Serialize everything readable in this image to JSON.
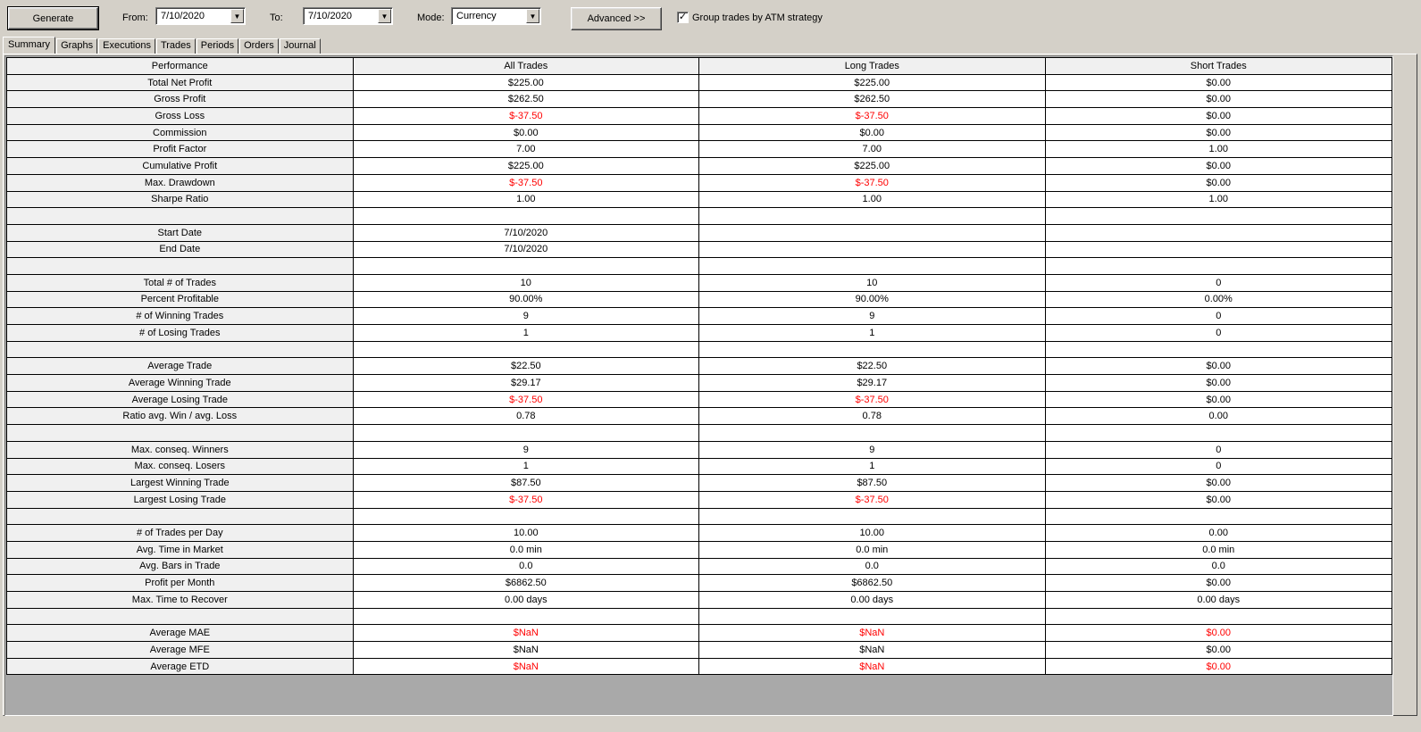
{
  "toolbar": {
    "generate_label": "Generate",
    "from_label": "From:",
    "from_value": "7/10/2020",
    "to_label": "To:",
    "to_value": "7/10/2020",
    "mode_label": "Mode:",
    "mode_value": "Currency",
    "advanced_label": "Advanced >>",
    "group_checked": true,
    "group_label": "Group trades by ATM strategy"
  },
  "tabs": [
    "Summary",
    "Graphs",
    "Executions",
    "Trades",
    "Periods",
    "Orders",
    "Journal"
  ],
  "active_tab": "Summary",
  "colors": {
    "negative": "#ff0000",
    "background": "#d4d0c8",
    "header": "#f0f0f0"
  },
  "table": {
    "columns": [
      "Performance",
      "All Trades",
      "Long Trades",
      "Short Trades"
    ],
    "rows": [
      {
        "label": "Total Net Profit",
        "values": [
          "$225.00",
          "$225.00",
          "$0.00"
        ],
        "neg": [
          false,
          false,
          false
        ]
      },
      {
        "label": "Gross Profit",
        "values": [
          "$262.50",
          "$262.50",
          "$0.00"
        ],
        "neg": [
          false,
          false,
          false
        ]
      },
      {
        "label": "Gross Loss",
        "values": [
          "$-37.50",
          "$-37.50",
          "$0.00"
        ],
        "neg": [
          true,
          true,
          false
        ]
      },
      {
        "label": "Commission",
        "values": [
          "$0.00",
          "$0.00",
          "$0.00"
        ],
        "neg": [
          false,
          false,
          false
        ]
      },
      {
        "label": "Profit Factor",
        "values": [
          "7.00",
          "7.00",
          "1.00"
        ],
        "neg": [
          false,
          false,
          false
        ]
      },
      {
        "label": "Cumulative Profit",
        "values": [
          "$225.00",
          "$225.00",
          "$0.00"
        ],
        "neg": [
          false,
          false,
          false
        ]
      },
      {
        "label": "Max. Drawdown",
        "values": [
          "$-37.50",
          "$-37.50",
          "$0.00"
        ],
        "neg": [
          true,
          true,
          false
        ]
      },
      {
        "label": "Sharpe Ratio",
        "values": [
          "1.00",
          "1.00",
          "1.00"
        ],
        "neg": [
          false,
          false,
          false
        ]
      },
      {
        "label": "",
        "values": [
          "",
          "",
          ""
        ],
        "neg": [
          false,
          false,
          false
        ]
      },
      {
        "label": "Start Date",
        "values": [
          "7/10/2020",
          "",
          ""
        ],
        "neg": [
          false,
          false,
          false
        ]
      },
      {
        "label": "End Date",
        "values": [
          "7/10/2020",
          "",
          ""
        ],
        "neg": [
          false,
          false,
          false
        ]
      },
      {
        "label": "",
        "values": [
          "",
          "",
          ""
        ],
        "neg": [
          false,
          false,
          false
        ]
      },
      {
        "label": "Total # of Trades",
        "values": [
          "10",
          "10",
          "0"
        ],
        "neg": [
          false,
          false,
          false
        ]
      },
      {
        "label": "Percent Profitable",
        "values": [
          "90.00%",
          "90.00%",
          "0.00%"
        ],
        "neg": [
          false,
          false,
          false
        ]
      },
      {
        "label": "# of Winning Trades",
        "values": [
          "9",
          "9",
          "0"
        ],
        "neg": [
          false,
          false,
          false
        ]
      },
      {
        "label": "# of Losing Trades",
        "values": [
          "1",
          "1",
          "0"
        ],
        "neg": [
          false,
          false,
          false
        ]
      },
      {
        "label": "",
        "values": [
          "",
          "",
          ""
        ],
        "neg": [
          false,
          false,
          false
        ]
      },
      {
        "label": "Average Trade",
        "values": [
          "$22.50",
          "$22.50",
          "$0.00"
        ],
        "neg": [
          false,
          false,
          false
        ]
      },
      {
        "label": "Average Winning Trade",
        "values": [
          "$29.17",
          "$29.17",
          "$0.00"
        ],
        "neg": [
          false,
          false,
          false
        ]
      },
      {
        "label": "Average Losing Trade",
        "values": [
          "$-37.50",
          "$-37.50",
          "$0.00"
        ],
        "neg": [
          true,
          true,
          false
        ]
      },
      {
        "label": "Ratio avg. Win / avg. Loss",
        "values": [
          "0.78",
          "0.78",
          "0.00"
        ],
        "neg": [
          false,
          false,
          false
        ]
      },
      {
        "label": "",
        "values": [
          "",
          "",
          ""
        ],
        "neg": [
          false,
          false,
          false
        ]
      },
      {
        "label": "Max. conseq. Winners",
        "values": [
          "9",
          "9",
          "0"
        ],
        "neg": [
          false,
          false,
          false
        ]
      },
      {
        "label": "Max. conseq. Losers",
        "values": [
          "1",
          "1",
          "0"
        ],
        "neg": [
          false,
          false,
          false
        ]
      },
      {
        "label": "Largest Winning Trade",
        "values": [
          "$87.50",
          "$87.50",
          "$0.00"
        ],
        "neg": [
          false,
          false,
          false
        ]
      },
      {
        "label": "Largest Losing Trade",
        "values": [
          "$-37.50",
          "$-37.50",
          "$0.00"
        ],
        "neg": [
          true,
          true,
          false
        ]
      },
      {
        "label": "",
        "values": [
          "",
          "",
          ""
        ],
        "neg": [
          false,
          false,
          false
        ]
      },
      {
        "label": "# of Trades per Day",
        "values": [
          "10.00",
          "10.00",
          "0.00"
        ],
        "neg": [
          false,
          false,
          false
        ]
      },
      {
        "label": "Avg. Time in Market",
        "values": [
          "0.0 min",
          "0.0 min",
          "0.0 min"
        ],
        "neg": [
          false,
          false,
          false
        ]
      },
      {
        "label": "Avg. Bars in Trade",
        "values": [
          "0.0",
          "0.0",
          "0.0"
        ],
        "neg": [
          false,
          false,
          false
        ]
      },
      {
        "label": "Profit per Month",
        "values": [
          "$6862.50",
          "$6862.50",
          "$0.00"
        ],
        "neg": [
          false,
          false,
          false
        ]
      },
      {
        "label": "Max. Time to Recover",
        "values": [
          "0.00 days",
          "0.00 days",
          "0.00 days"
        ],
        "neg": [
          false,
          false,
          false
        ]
      },
      {
        "label": "",
        "values": [
          "",
          "",
          ""
        ],
        "neg": [
          false,
          false,
          false
        ]
      },
      {
        "label": "Average MAE",
        "values": [
          "$NaN",
          "$NaN",
          "$0.00"
        ],
        "neg": [
          true,
          true,
          true
        ]
      },
      {
        "label": "Average MFE",
        "values": [
          "$NaN",
          "$NaN",
          "$0.00"
        ],
        "neg": [
          false,
          false,
          false
        ]
      },
      {
        "label": "Average ETD",
        "values": [
          "$NaN",
          "$NaN",
          "$0.00"
        ],
        "neg": [
          true,
          true,
          true
        ]
      }
    ]
  }
}
